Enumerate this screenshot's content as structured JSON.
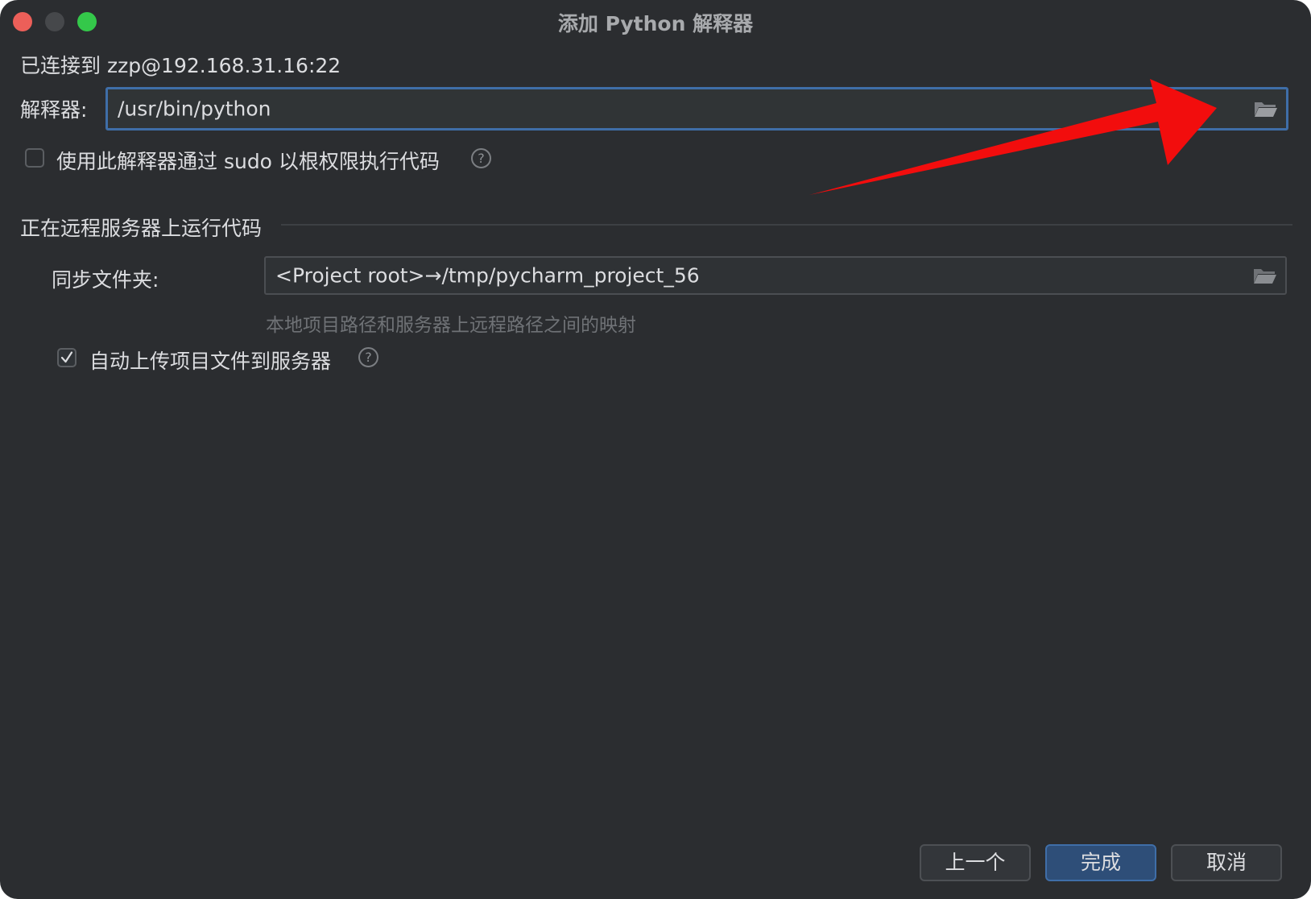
{
  "window": {
    "title": "添加 Python 解释器"
  },
  "connection": {
    "text": "已连接到 zzp@192.168.31.16:22"
  },
  "interpreter": {
    "label": "解释器:",
    "value": "/usr/bin/python"
  },
  "sudo": {
    "label": "使用此解释器通过 sudo 以根权限执行代码",
    "checked": false
  },
  "remote_section": {
    "title": "正在远程服务器上运行代码"
  },
  "sync": {
    "label": "同步文件夹:",
    "value": "<Project root>→/tmp/pycharm_project_56",
    "hint": "本地项目路径和服务器上远程路径之间的映射"
  },
  "auto_upload": {
    "label": "自动上传项目文件到服务器",
    "checked": true
  },
  "buttons": {
    "previous": "上一个",
    "finish": "完成",
    "cancel": "取消"
  },
  "icons": {
    "folder": "folder-icon",
    "help": "help-icon",
    "check": "check-icon",
    "annotation": "red-arrow-annotation"
  },
  "colors": {
    "background": "#2b2d30",
    "accent": "#3f6ea8",
    "annotation_red": "#f20d0d",
    "close": "#ec5f59",
    "maximize": "#34c84a"
  }
}
